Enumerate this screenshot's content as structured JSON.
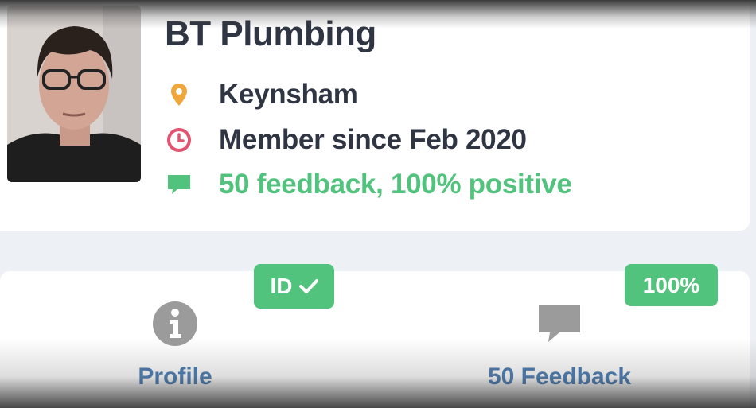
{
  "profile": {
    "business_name": "BT Plumbing",
    "location": "Keynsham",
    "member_since": "Member since Feb 2020",
    "feedback_summary": "50 feedback, 100% positive"
  },
  "badges": {
    "id_label": "ID",
    "percent_label": "100%"
  },
  "tabs": [
    {
      "label": "Profile",
      "icon": "info-icon"
    },
    {
      "label": "50 Feedback",
      "icon": "chat-bubble-icon"
    }
  ],
  "icons": {
    "location": "map-pin-icon",
    "member": "clock-icon",
    "feedback": "chat-bubble-icon"
  },
  "colors": {
    "pin": "#f0a63a",
    "clock": "#e25470",
    "green": "#51c37d",
    "link_blue": "#3d73ad",
    "dark_text": "#2f3542",
    "gray_icon": "#9b9b9b"
  }
}
